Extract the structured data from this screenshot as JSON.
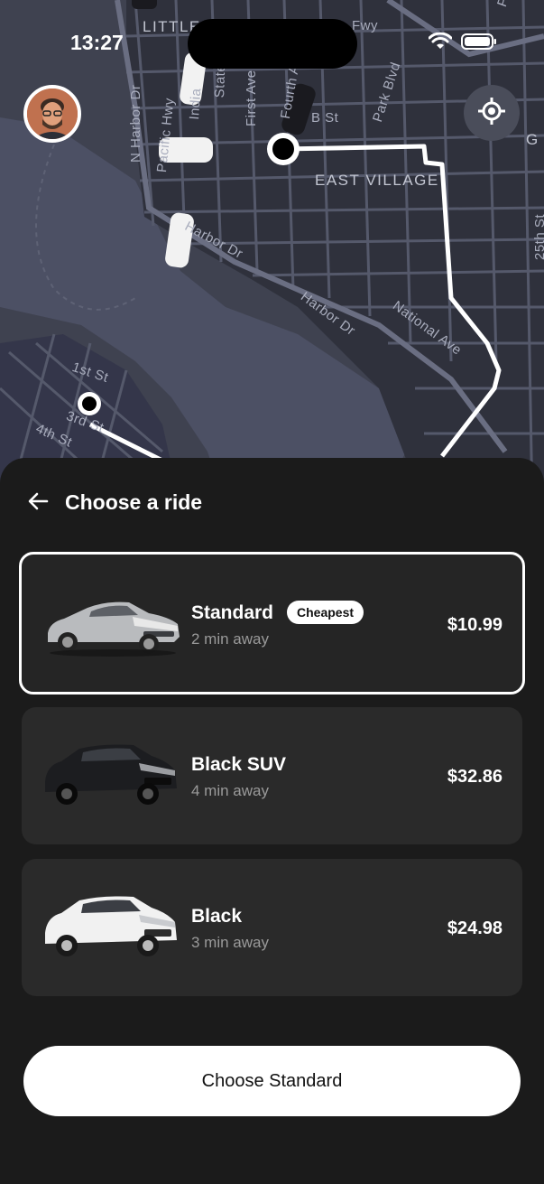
{
  "status_bar": {
    "time": "13:27"
  },
  "map": {
    "labels": {
      "little": "LITTLE",
      "fwy": "Fwy",
      "pershing": "Pershing Dr",
      "b_st": "B St",
      "east_village": "EAST VILLAGE",
      "n_harbor": "N Harbor Dr",
      "pacific_hwy": "Pacific Hwy",
      "first_ave": "First Ave",
      "fourth_ave": "Fourth Ave",
      "park_blvd": "Park Blvd",
      "india": "India",
      "state": "State",
      "harbor_dr_1": "Harbor Dr",
      "harbor_dr_2": "Harbor Dr",
      "national_ave": "National Ave",
      "first_st": "1st St",
      "third_st": "3rd St",
      "fourth_st": "4th St",
      "g": "G",
      "twentyfifth": "25th St"
    },
    "route_color": "#ffffff",
    "map_bg": "#3f4250"
  },
  "header": {
    "title": "Choose a ride"
  },
  "rides": [
    {
      "name": "Standard",
      "badge": "Cheapest",
      "eta": "2 min away",
      "price": "$10.99",
      "selected": true,
      "car_color": "silver"
    },
    {
      "name": "Black SUV",
      "eta": "4 min away",
      "price": "$32.86",
      "selected": false,
      "car_color": "black"
    },
    {
      "name": "Black",
      "eta": "3 min away",
      "price": "$24.98",
      "selected": false,
      "car_color": "white"
    }
  ],
  "cta": {
    "label": "Choose Standard"
  },
  "icons": {
    "back": "arrow-left-icon",
    "locate": "crosshair-icon",
    "wifi": "wifi-icon",
    "battery": "battery-icon"
  }
}
